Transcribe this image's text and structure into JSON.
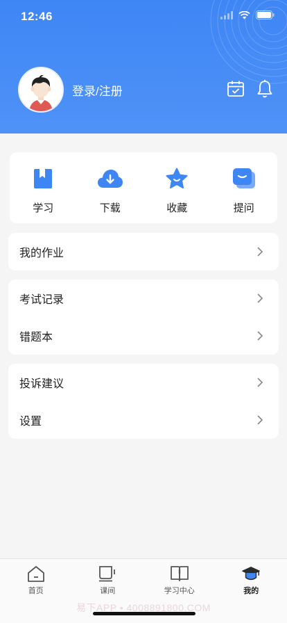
{
  "status_bar": {
    "time": "12:46"
  },
  "profile": {
    "login_label": "登录/注册"
  },
  "colors": {
    "brand": "#3f86f5",
    "icon_blue": "#3f86f5",
    "background": "#f5f5f5"
  },
  "quick_actions": [
    {
      "label": "学习",
      "icon": "bookmark-book-icon"
    },
    {
      "label": "下载",
      "icon": "cloud-download-icon"
    },
    {
      "label": "收藏",
      "icon": "star-icon"
    },
    {
      "label": "提问",
      "icon": "chat-bubble-icon"
    }
  ],
  "menu_groups": [
    {
      "items": [
        "我的作业"
      ]
    },
    {
      "items": [
        "考试记录",
        "错题本"
      ]
    },
    {
      "items": [
        "投诉建议",
        "设置"
      ]
    }
  ],
  "tabbar": {
    "tabs": [
      {
        "label": "首页",
        "icon": "home-icon"
      },
      {
        "label": "课间",
        "icon": "coffee-cup-icon"
      },
      {
        "label": "学习中心",
        "icon": "open-book-icon"
      },
      {
        "label": "我的",
        "icon": "graduation-cap-icon"
      }
    ],
    "active": "我的"
  },
  "watermark": "易下APP • 4008891800.COM"
}
